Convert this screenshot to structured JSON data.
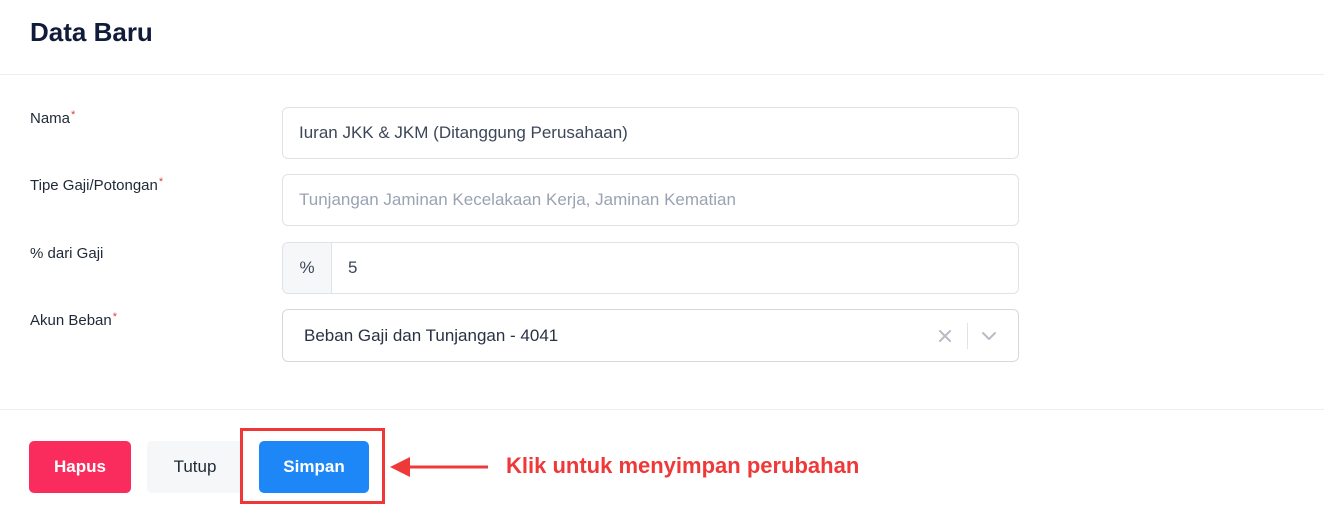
{
  "modal": {
    "title": "Data Baru"
  },
  "form": {
    "required_mark": "*",
    "nama": {
      "label": "Nama",
      "value": "Iuran JKK & JKM (Ditanggung Perusahaan)"
    },
    "tipe": {
      "label": "Tipe Gaji/Potongan",
      "placeholder": "Tunjangan Jaminan Kecelakaan Kerja, Jaminan Kematian"
    },
    "persen": {
      "label": "% dari Gaji",
      "addon": "%",
      "value": "5"
    },
    "akun": {
      "label": "Akun Beban",
      "selected": "Beban Gaji dan Tunjangan - 4041",
      "clear_icon": "x-icon",
      "dropdown_icon": "chevron-down-icon"
    }
  },
  "footer": {
    "delete_label": "Hapus",
    "close_label": "Tutup",
    "save_label": "Simpan"
  },
  "annotation": {
    "text": "Klik untuk menyimpan perubahan",
    "color": "#ef3838"
  },
  "colors": {
    "delete": "#fa2c5d",
    "save": "#1d87f7",
    "title": "#111b3a"
  }
}
